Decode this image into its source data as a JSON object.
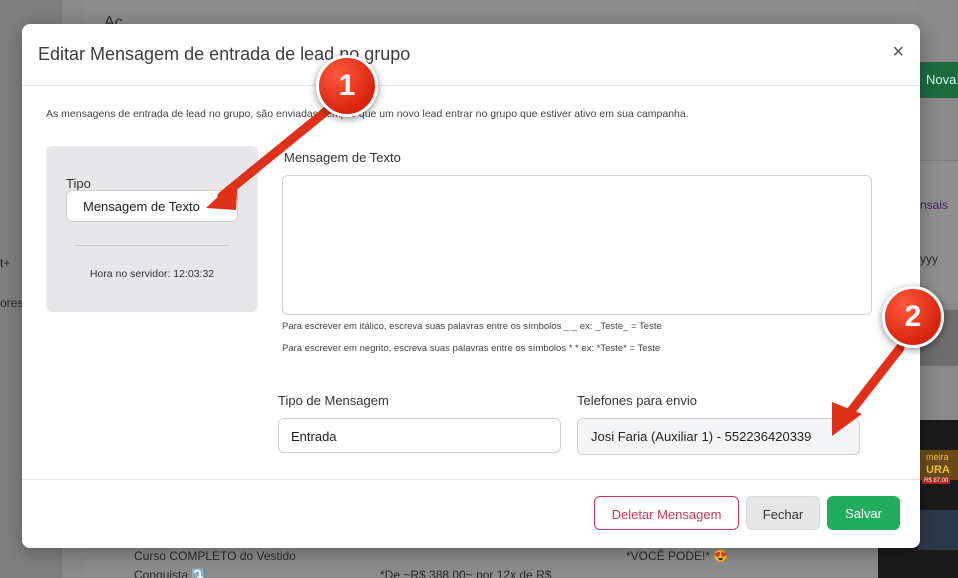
{
  "background": {
    "texts": [
      "Aç",
      "t+",
      "ores",
      "Nova",
      "nsais",
      "yyy",
      "meira",
      "URA",
      "R$ 87,00",
      "Curso COMPLETO do Vestido",
      "Conquista ⤵️",
      "*De ~R$ 388,00~ por 12x de R$",
      "*VOCÊ PODE!* 😍"
    ]
  },
  "modal": {
    "title": "Editar Mensagem de entrada de lead no grupo",
    "close_label": "×",
    "intro": "As mensagens de entrada de lead no grupo, são enviadas sempre que um novo lead entrar no grupo que estiver ativo em sua campanha.",
    "side": {
      "tipo_label": "Tipo",
      "tipo_value": "Mensagem de Texto",
      "server_time": "Hora no servidor: 12:03:32"
    },
    "message": {
      "label": "Mensagem de Texto",
      "value": "",
      "hint_italic": "Para escrever em itálico, escreva suas palavras entre os símbolos _ _ ex: _Teste_ = Teste",
      "hint_bold": "Para escrever em negrito, escreva suas palavras entre os símbolos * * ex: *Teste* = Teste"
    },
    "tipo_mensagem": {
      "label": "Tipo de Mensagem",
      "value": "Entrada"
    },
    "telefones": {
      "label": "Telefones para envio",
      "value": "Josi Faria (Auxiliar 1) - 552236420339"
    },
    "buttons": {
      "delete": "Deletar Mensagem",
      "close": "Fechar",
      "save": "Salvar"
    }
  },
  "annotations": {
    "badge1": "1",
    "badge2": "2",
    "color": "#e0301a"
  }
}
